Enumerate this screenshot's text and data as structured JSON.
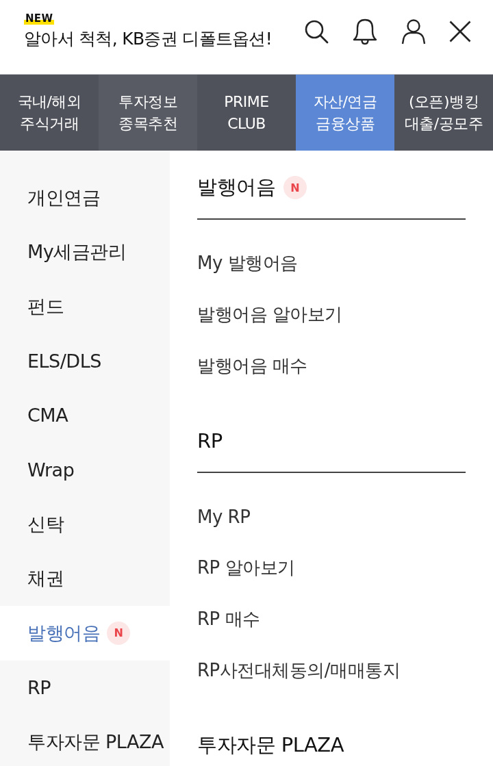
{
  "header": {
    "badge": "NEW",
    "title": "알아서 척척, KB증권 디폴트옵션!"
  },
  "tabs": [
    {
      "lines": [
        "국내/해외",
        "주식거래"
      ],
      "selected": false
    },
    {
      "lines": [
        "투자정보",
        "종목추천"
      ],
      "selected": false
    },
    {
      "lines": [
        "PRIME",
        "CLUB"
      ],
      "selected": false
    },
    {
      "lines": [
        "자산/연금",
        "금융상품"
      ],
      "selected": true
    },
    {
      "lines": [
        "(오픈)뱅킹",
        "대출/공모주"
      ],
      "selected": false
    }
  ],
  "sidebar": {
    "items": [
      {
        "label": "개인연금",
        "selected": false
      },
      {
        "label": "My세금관리",
        "selected": false
      },
      {
        "label": "펀드",
        "selected": false
      },
      {
        "label": "ELS/DLS",
        "selected": false
      },
      {
        "label": "CMA",
        "selected": false
      },
      {
        "label": "Wrap",
        "selected": false
      },
      {
        "label": "신탁",
        "selected": false
      },
      {
        "label": "채권",
        "selected": false
      },
      {
        "label": "발행어음",
        "badge": "N",
        "selected": true
      },
      {
        "label": "RP",
        "selected": false
      },
      {
        "label": "투자자문 PLAZA",
        "selected": false
      }
    ]
  },
  "sections": [
    {
      "title": "발행어음",
      "badge": "N",
      "links": [
        "My 발행어음",
        "발행어음 알아보기",
        "발행어음 매수"
      ]
    },
    {
      "title": "RP",
      "links": [
        "My RP",
        "RP 알아보기",
        "RP 매수",
        "RP사전대체동의/매매통지"
      ]
    },
    {
      "title": "투자자문 PLAZA"
    }
  ]
}
